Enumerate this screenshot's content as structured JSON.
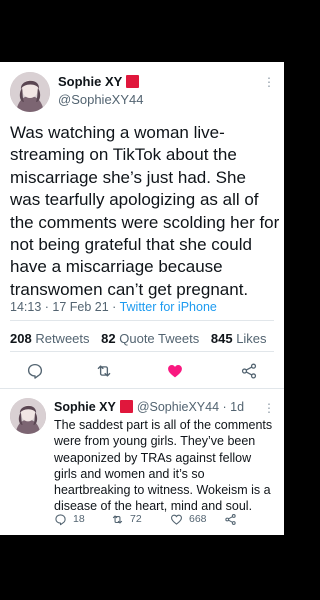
{
  "main_tweet": {
    "display_name": "Sophie XY",
    "handle": "@SophieXY44",
    "text": "Was watching a woman live-streaming on TikTok about the miscarriage she’s just had. She was tearfully apologizing as all of the comments were scolding her for not being grateful that she could have a miscarriage because transwomen can’t get pregnant.",
    "timestamp": "14:13 · 17 Feb 21 · ",
    "source": "Twitter for iPhone",
    "retweets_count": "208",
    "retweets_label": "Retweets",
    "quote_count": "82",
    "quote_label": "Quote Tweets",
    "likes_count": "845",
    "likes_label": "Likes",
    "liked": true
  },
  "reply": {
    "display_name": "Sophie XY",
    "handle_time": "@SophieXY44 · 1d",
    "text": "The saddest part is all of the comments were from young girls. They’ve been weaponized by TRAs against fellow girls and women and it’s so heartbreaking to witness. Wokeism is a disease of the heart, mind and soul.",
    "reply_count": "18",
    "retweet_count": "72",
    "like_count": "668"
  },
  "colors": {
    "flag": "#e0173c",
    "like_active": "#f91880",
    "source_link": "#1d9bf0",
    "secondary_text": "#536471"
  },
  "icons": [
    "more-icon",
    "reply-icon",
    "retweet-icon",
    "like-icon",
    "share-icon",
    "flag-icon"
  ]
}
